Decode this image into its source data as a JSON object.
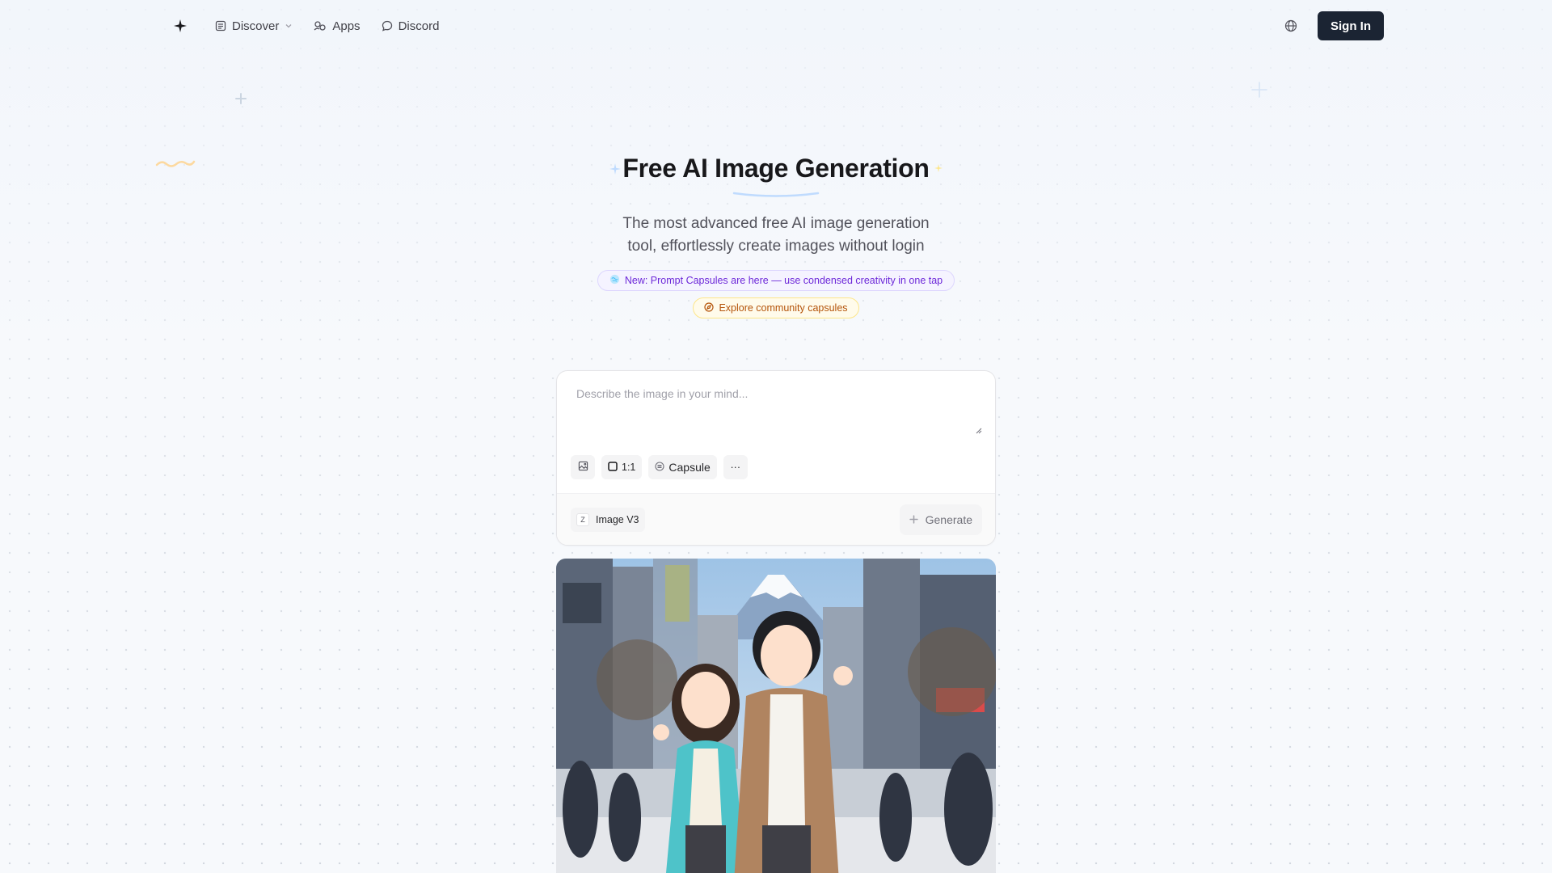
{
  "nav": {
    "discover_label": "Discover",
    "apps_label": "Apps",
    "discord_label": "Discord",
    "signin_label": "Sign In"
  },
  "hero": {
    "title": "Free AI Image Generation",
    "subtitle": "The most advanced free AI image generation tool, effortlessly create images without login"
  },
  "announcement": {
    "new_label": "New: Prompt Capsules are here — use condensed creativity in one tap",
    "explore_label": "Explore community capsules"
  },
  "prompt": {
    "placeholder": "Describe the image in your mind...",
    "value": ""
  },
  "toolbar": {
    "aspect_ratio": "1:1",
    "capsule_label": "Capsule",
    "more_label": "···"
  },
  "model": {
    "logo_letter": "Z",
    "name": "Image V3"
  },
  "generate_label": "Generate",
  "colors": {
    "signin_bg": "#1b2433",
    "new_pill_text": "#6d28d9",
    "explore_pill_text": "#b45309"
  },
  "icons": [
    "sparkle-logo-icon",
    "discover-icon",
    "chevron-down-icon",
    "apps-icon",
    "discord-chat-icon",
    "globe-icon",
    "image-upload-icon",
    "aspect-square-icon",
    "capsule-icon",
    "more-icon",
    "plus-icon"
  ]
}
